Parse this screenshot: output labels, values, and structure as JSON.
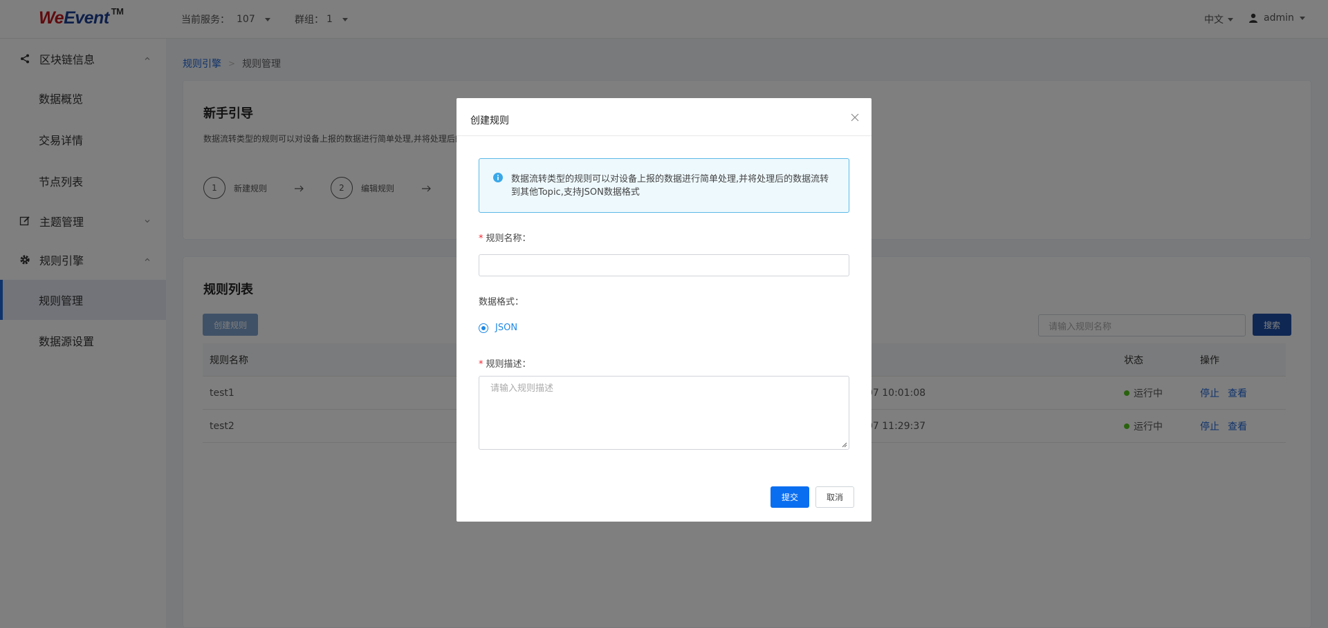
{
  "header": {
    "logo_prefix": "We",
    "logo_rest": "Event",
    "logo_tm": "TM",
    "service_label": "当前服务：",
    "service_value": "107",
    "group_label": "群组：",
    "group_value": "1",
    "language": "中文",
    "user": "admin"
  },
  "sidebar": {
    "items": [
      {
        "label": "区块链信息",
        "icon": "share-icon"
      },
      {
        "label": "数据概览"
      },
      {
        "label": "交易详情"
      },
      {
        "label": "节点列表"
      },
      {
        "label": "主题管理",
        "icon": "edit-icon"
      },
      {
        "label": "规则引擎",
        "icon": "gear-icon"
      },
      {
        "label": "规则管理"
      },
      {
        "label": "数据源设置"
      }
    ]
  },
  "breadcrumb": {
    "parent": "规则引擎",
    "current": "规则管理"
  },
  "guide": {
    "title": "新手引导",
    "desc": "数据流转类型的规则可以对设备上报的数据进行简单处理,并将处理后的",
    "steps": [
      {
        "num": "1",
        "label": "新建规则"
      },
      {
        "num": "2",
        "label": "编辑规则"
      }
    ]
  },
  "rules": {
    "title": "规则列表",
    "create_button": "创建规则",
    "search_placeholder": "请输入规则名称",
    "search_button": "搜索",
    "columns": {
      "name": "规则名称",
      "status": "状态",
      "actions": "操作"
    },
    "rows": [
      {
        "name": "test1",
        "time": "07 10:01:08",
        "status": "运行中",
        "stop": "停止",
        "view": "查看"
      },
      {
        "name": "test2",
        "time": "07 11:29:37",
        "status": "运行中",
        "stop": "停止",
        "view": "查看"
      }
    ]
  },
  "modal": {
    "title": "创建规则",
    "alert": "数据流转类型的规则可以对设备上报的数据进行简单处理,并将处理后的数据流转到其他Topic,支持JSON数据格式",
    "name_label": "规则名称：",
    "format_label": "数据格式：",
    "format_value": "JSON",
    "desc_label": "规则描述：",
    "desc_placeholder": "请输入规则描述",
    "submit": "提交",
    "cancel": "取消"
  },
  "colors": {
    "primary": "#0a6ef0",
    "status_running": "#52c41a",
    "alert_border": "#5ab8e6"
  }
}
